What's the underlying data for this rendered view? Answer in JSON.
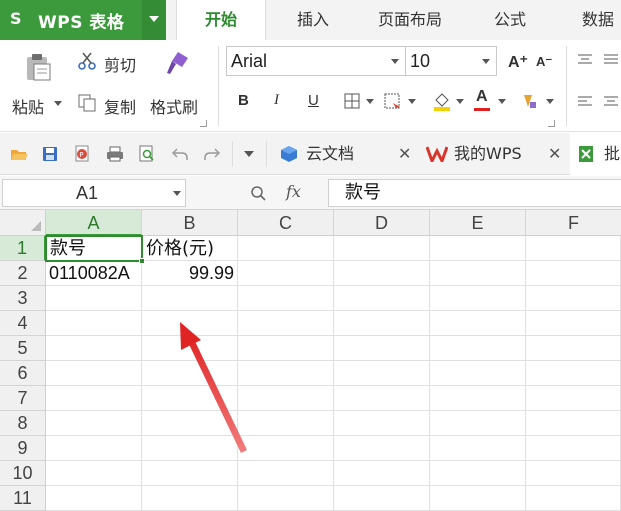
{
  "app": {
    "name": "WPS 表格",
    "logo": "S"
  },
  "menu": {
    "tabs": [
      "开始",
      "插入",
      "页面布局",
      "公式",
      "数据"
    ],
    "active": 0
  },
  "ribbon": {
    "paste_label": "粘贴",
    "cut_label": "剪切",
    "copy_label": "复制",
    "format_painter_label": "格式刷",
    "font_name": "Arial",
    "font_size": "10",
    "bold_label": "B",
    "italic_label": "I",
    "underline_label": "U",
    "increase_font": "A⁺",
    "decrease_font": "A⁻",
    "font_color_label": "A"
  },
  "doc_tabs": [
    {
      "label": "云文档",
      "active": false
    },
    {
      "label": "我的WPS",
      "active": false
    },
    {
      "label": "批",
      "active": true
    }
  ],
  "formula_bar": {
    "cell_ref": "A1",
    "fx": "fx",
    "content": "款号"
  },
  "sheet": {
    "columns": [
      "A",
      "B",
      "C",
      "D",
      "E",
      "F"
    ],
    "rows": [
      "1",
      "2",
      "3",
      "4",
      "5",
      "6",
      "7",
      "8",
      "9",
      "10",
      "11"
    ],
    "cells": {
      "A1": "款号",
      "B1": "价格(元)",
      "A2": "0110082A",
      "B2": "99.99"
    }
  },
  "colors": {
    "accent": "#3c9a3c",
    "selection": "#2e8b2e",
    "arrow": "#e23030"
  }
}
